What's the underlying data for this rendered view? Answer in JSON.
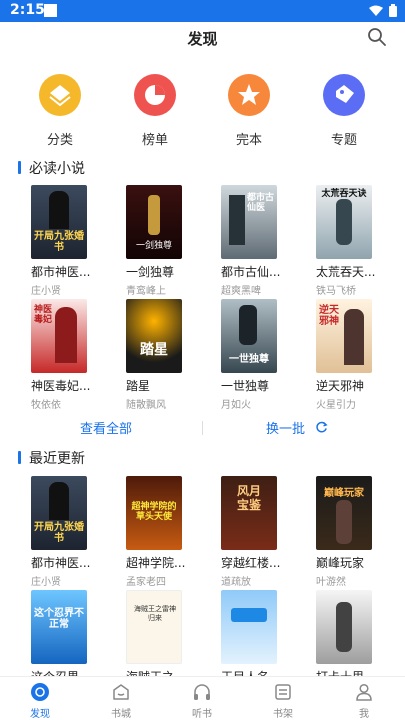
{
  "status": {
    "time": "2:15"
  },
  "header": {
    "title": "发现"
  },
  "categories": [
    {
      "label": "分类",
      "color": "#f5b82a",
      "icon": "category-icon"
    },
    {
      "label": "榜单",
      "color": "#ef5350",
      "icon": "ranking-icon"
    },
    {
      "label": "完本",
      "color": "#f7883b",
      "icon": "star-icon"
    },
    {
      "label": "专题",
      "color": "#5b6df5",
      "icon": "tag-icon"
    }
  ],
  "must_read": {
    "title": "必读小说",
    "books": [
      {
        "title": "都市神医...",
        "author": "庄小贤",
        "cover_text": "开局九张婚书"
      },
      {
        "title": "一剑独尊",
        "author": "青鸾峰上",
        "cover_text": "一剑独尊"
      },
      {
        "title": "都市古仙...",
        "author": "超爽黑啤",
        "cover_text": "都市古仙医"
      },
      {
        "title": "太荒吞天...",
        "author": "铁马飞桥",
        "cover_text": "太荒吞天诀"
      },
      {
        "title": "神医毒妃...",
        "author": "牧依依",
        "cover_text": "神医毒妃"
      },
      {
        "title": "踏星",
        "author": "随散飘风",
        "cover_text": "踏星"
      },
      {
        "title": "一世独尊",
        "author": "月如火",
        "cover_text": "一世独尊"
      },
      {
        "title": "逆天邪神",
        "author": "火星引力",
        "cover_text": "逆天邪神"
      }
    ]
  },
  "actions": {
    "view_all": "查看全部",
    "refresh": "换一批"
  },
  "recent": {
    "title": "最近更新",
    "books": [
      {
        "title": "都市神医...",
        "author": "庄小贤",
        "cover_text": "开局九张婚书"
      },
      {
        "title": "超神学院...",
        "author": "孟家老四",
        "cover_text": "超神学院的草头天使"
      },
      {
        "title": "穿越红楼...",
        "author": "道疏放",
        "cover_text": "风月宝鉴"
      },
      {
        "title": "巅峰玩家",
        "author": "叶游然",
        "cover_text": "巅峰玩家"
      },
      {
        "title": "这个忍界...",
        "author": "",
        "cover_text": "这个忍界不正常"
      },
      {
        "title": "海贼王之...",
        "author": "",
        "cover_text": "海贼王之雷神归来"
      },
      {
        "title": "王目人名...",
        "author": "",
        "cover_text": ""
      },
      {
        "title": "打卡十里...",
        "author": "",
        "cover_text": ""
      }
    ]
  },
  "bottom_nav": [
    {
      "label": "发现",
      "icon": "discover-icon",
      "active": true
    },
    {
      "label": "书城",
      "icon": "bookstore-icon",
      "active": false
    },
    {
      "label": "听书",
      "icon": "headphones-icon",
      "active": false
    },
    {
      "label": "书架",
      "icon": "bookshelf-icon",
      "active": false
    },
    {
      "label": "我",
      "icon": "profile-icon",
      "active": false
    }
  ]
}
